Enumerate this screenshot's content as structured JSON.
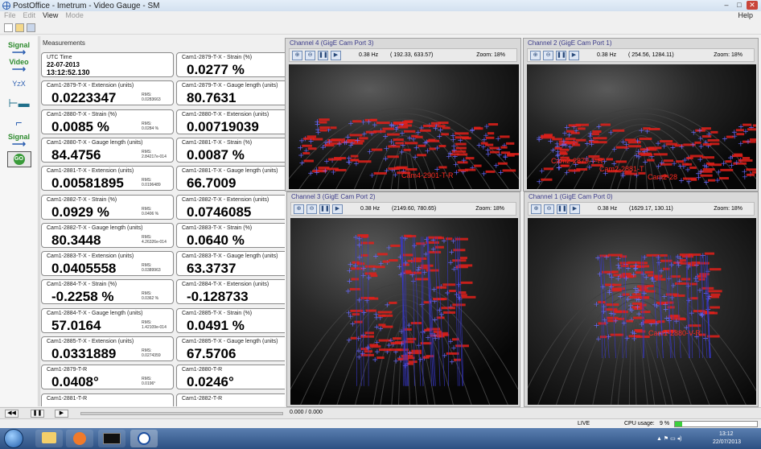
{
  "window": {
    "title": "PostOffice - Imetrum - Video Gauge - SM"
  },
  "menu": {
    "items": [
      "File",
      "Edit",
      "View",
      "Mode"
    ],
    "active": [
      "View"
    ],
    "help": "Help"
  },
  "leftpanel": {
    "signal_in": "Signal",
    "video": "Video",
    "signal_out": "Signal",
    "go": "GO"
  },
  "measurements": {
    "title": "Measurements",
    "left": [
      {
        "label": "UTC Time",
        "value": "22-07-2013",
        "value2": "13:12:52.130",
        "type": "time"
      },
      {
        "label": "Cam1-2879-T-X - Extension (units)",
        "value": "0.0223347",
        "rms": "RMS:",
        "rmsv": "0.0283663"
      },
      {
        "label": "Cam1-2880-T-X - Strain (%)",
        "value": "0.0085 %",
        "rms": "RMS:",
        "rmsv": "0.0284 %"
      },
      {
        "label": "Cam1-2880-T-X - Gauge length (units)",
        "value": "84.4756",
        "rms": "RMS:",
        "rmsv": "2.84217e-014"
      },
      {
        "label": "Cam1-2881-T-X - Extension (units)",
        "value": "0.00581895",
        "rms": "RMS:",
        "rmsv": "0.0196489"
      },
      {
        "label": "Cam1-2882-T-X - Strain (%)",
        "value": "0.0929 %",
        "rms": "RMS:",
        "rmsv": "0.0406 %"
      },
      {
        "label": "Cam1-2882-T-X - Gauge length (units)",
        "value": "80.3448",
        "rms": "RMS:",
        "rmsv": "4.26326e-014"
      },
      {
        "label": "Cam1-2883-T-X - Extension (units)",
        "value": "0.0405558",
        "rms": "RMS:",
        "rmsv": "0.0389963"
      },
      {
        "label": "Cam1-2884-T-X - Strain (%)",
        "value": "-0.2258 %",
        "rms": "RMS:",
        "rmsv": "0.0362 %"
      },
      {
        "label": "Cam1-2884-T-X - Gauge length (units)",
        "value": "57.0164",
        "rms": "RMS:",
        "rmsv": "1.42109e-014"
      },
      {
        "label": "Cam1-2885-T-X - Extension (units)",
        "value": "0.0331889",
        "rms": "RMS:",
        "rmsv": "0.0274359"
      },
      {
        "label": "Cam1-2879-T-R",
        "value": "0.0408°",
        "rms": "RMS:",
        "rmsv": "0.0196°"
      },
      {
        "label": "Cam1-2881-T-R",
        "value": "",
        "rms": "",
        "rmsv": ""
      }
    ],
    "right": [
      {
        "label": "Cam1-2879-T-X - Strain (%)",
        "value": "0.0277 %"
      },
      {
        "label": "Cam1-2879-T-X - Gauge length (units)",
        "value": "80.7631"
      },
      {
        "label": "Cam1-2880-T-X - Extension (units)",
        "value": "0.00719039"
      },
      {
        "label": "Cam1-2881-T-X - Strain (%)",
        "value": "0.0087 %"
      },
      {
        "label": "Cam1-2881-T-X - Gauge length (units)",
        "value": "66.7009"
      },
      {
        "label": "Cam1-2882-T-X - Extension (units)",
        "value": "0.0746085"
      },
      {
        "label": "Cam1-2883-T-X - Strain (%)",
        "value": "0.0640 %"
      },
      {
        "label": "Cam1-2883-T-X - Gauge length (units)",
        "value": "63.3737"
      },
      {
        "label": "Cam1-2884-T-X - Extension (units)",
        "value": "-0.128733"
      },
      {
        "label": "Cam1-2885-T-X - Strain (%)",
        "value": "0.0491 %"
      },
      {
        "label": "Cam1-2885-T-X - Gauge length (units)",
        "value": "67.5706"
      },
      {
        "label": "Cam1-2880-T-R",
        "value": "0.0246°"
      },
      {
        "label": "Cam1-2882-T-R",
        "value": ""
      }
    ]
  },
  "channels": [
    {
      "title": "Channel 4 (GigE Cam Port 3)",
      "hz": "0.38 Hz",
      "coords": "( 192.33, 633.57)",
      "zoom": "Zoom: 18%",
      "labels": [
        "Cam4-2901-T-R"
      ]
    },
    {
      "title": "Channel 2 (GigE Cam Port 1)",
      "hz": "0.38 Hz",
      "coords": "( 254.56, 1284.11)",
      "zoom": "Zoom: 18%",
      "labels": [
        "Cam2-2879-T-R",
        "Cam2-2881-T",
        "Cam2-28"
      ]
    },
    {
      "title": "Channel 3 (GigE Cam Port 2)",
      "hz": "0.38 Hz",
      "coords": "(2149.60, 780.65)",
      "zoom": "Zoom: 18%",
      "labels": []
    },
    {
      "title": "Channel 1 (GigE Cam Port 0)",
      "hz": "0.38 Hz",
      "coords": "(1629.17, 130.11)",
      "zoom": "Zoom: 18%",
      "labels": [
        "Cam1-2880-V-R"
      ]
    }
  ],
  "bottom": {
    "progress": "0.000 / 0.000"
  },
  "status": {
    "mode": "LIVE",
    "cpu_label": "CPU usage:",
    "cpu": "9 %",
    "cpu_fraction": 0.09
  },
  "taskbar": {
    "time": "13:12",
    "date": "22/07/2013"
  }
}
